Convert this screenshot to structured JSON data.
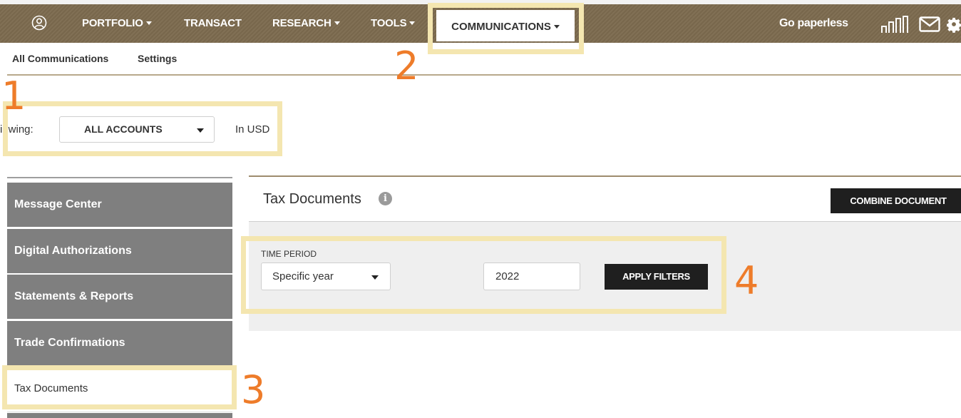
{
  "nav": {
    "items": [
      "PORTFOLIO",
      "TRANSACT",
      "RESEARCH",
      "TOOLS",
      "COMMUNICATIONS"
    ],
    "go_paperless": "Go paperless",
    "icons": [
      "user-icon",
      "chart-icon",
      "mail-icon",
      "gear-icon"
    ]
  },
  "subnav": {
    "all_communications": "All Communications",
    "settings": "Settings"
  },
  "viewing": {
    "label": "iewing:",
    "account": "ALL ACCOUNTS",
    "currency": "In USD"
  },
  "sidebar": {
    "items": [
      "Message Center",
      "Digital Authorizations",
      "Statements & Reports",
      "Trade Confirmations",
      "Tax Documents"
    ],
    "active_index": 4
  },
  "panel": {
    "title": "Tax Documents",
    "info": "i",
    "combine_button": "COMBINE DOCUMENT",
    "filters": {
      "time_period_label": "TIME PERIOD",
      "period": "Specific year",
      "year": "2022",
      "apply_button": "APPLY FILTERS"
    }
  },
  "callouts": [
    "1",
    "2",
    "3",
    "4"
  ],
  "colors": {
    "nav_bg": "#7c6a4e",
    "sidebar_bg": "#7f7f7f",
    "highlight": "#f4e6b0",
    "callout": "#ee7c2a",
    "button": "#1f1f1f"
  }
}
